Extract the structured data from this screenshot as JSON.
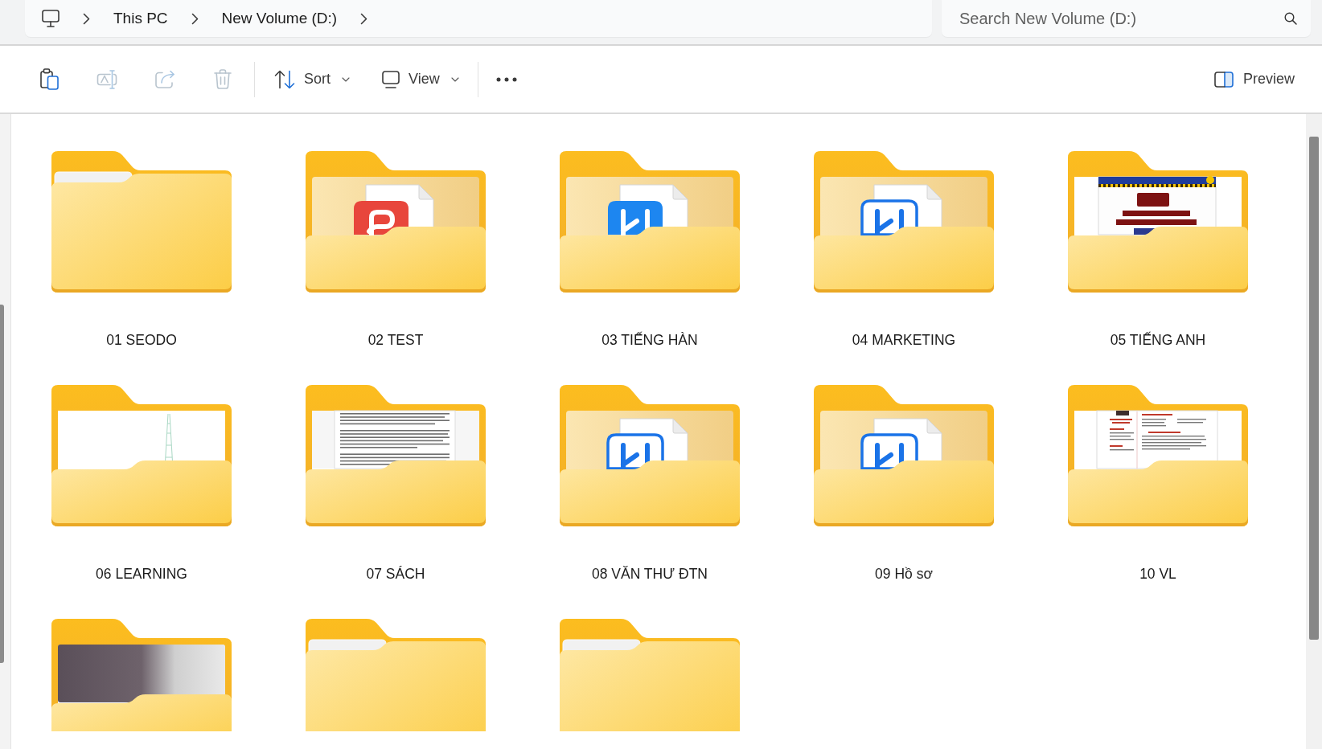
{
  "address_bar": {
    "crumbs": [
      "This PC",
      "New Volume (D:)"
    ]
  },
  "search": {
    "placeholder": "Search New Volume (D:)"
  },
  "toolbar": {
    "items": [
      {
        "kind": "paste",
        "disabled": false
      },
      {
        "kind": "rename",
        "disabled": true
      },
      {
        "kind": "share",
        "disabled": true
      },
      {
        "kind": "delete",
        "disabled": true
      },
      {
        "kind": "sort",
        "label": "Sort",
        "disabled": false
      },
      {
        "kind": "view",
        "label": "View",
        "disabled": false
      },
      {
        "kind": "more",
        "disabled": false
      }
    ],
    "preview": {
      "label": "Preview"
    }
  },
  "folders": [
    {
      "name": "01 SEODO",
      "kind": "empty"
    },
    {
      "name": "02 TEST",
      "kind": "file-red-tile"
    },
    {
      "name": "03 TIẾNG HÀN",
      "kind": "file-blue-tile"
    },
    {
      "name": "04 MARKETING",
      "kind": "file-outline-tile"
    },
    {
      "name": "05 TIẾNG ANH",
      "kind": "book-cover"
    },
    {
      "name": "06 LEARNING",
      "kind": "image"
    },
    {
      "name": "07 SÁCH",
      "kind": "text-document"
    },
    {
      "name": "08 VĂN THƯ ĐTN",
      "kind": "file-outline-tile"
    },
    {
      "name": "09 Hồ sơ",
      "kind": "file-outline-tile"
    },
    {
      "name": "10 VL",
      "kind": "resume"
    },
    {
      "kind": "photo"
    },
    {
      "kind": "empty"
    },
    {
      "kind": "empty"
    }
  ]
}
